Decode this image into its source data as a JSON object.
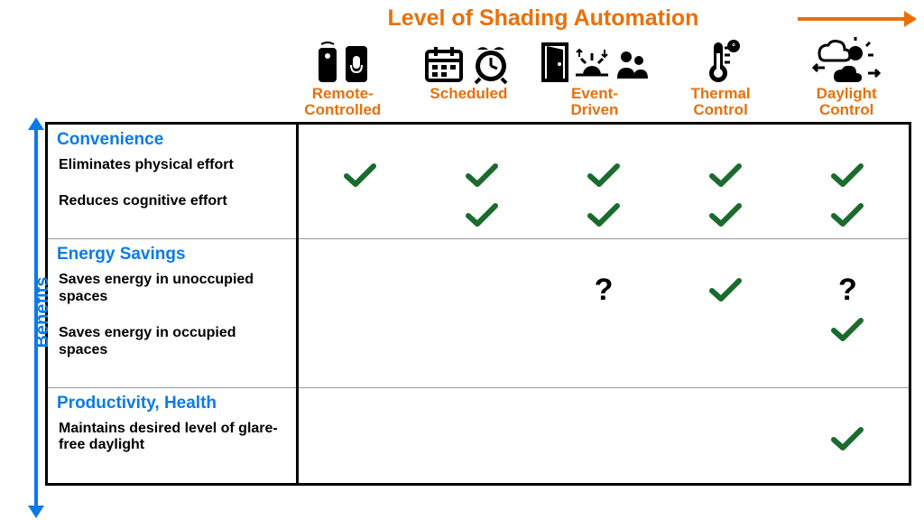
{
  "top_axis_label": "Level of Shading Automation",
  "left_axis_label": "Benefits",
  "columns": [
    {
      "id": "remote",
      "label": "Remote-\nControlled"
    },
    {
      "id": "scheduled",
      "label": "Scheduled"
    },
    {
      "id": "event",
      "label": "Event-\nDriven"
    },
    {
      "id": "thermal",
      "label": "Thermal\nControl"
    },
    {
      "id": "daylight",
      "label": "Daylight\nControl"
    }
  ],
  "groups": [
    {
      "category": "Convenience",
      "rows": [
        {
          "label": "Eliminates physical effort",
          "marks": [
            "check",
            "check",
            "check",
            "check",
            "check"
          ]
        },
        {
          "label": "Reduces cognitive effort",
          "marks": [
            "",
            "check",
            "check",
            "check",
            "check"
          ]
        }
      ]
    },
    {
      "category": "Energy Savings",
      "rows": [
        {
          "label": "Saves energy in unoccupied spaces",
          "marks": [
            "",
            "",
            "question",
            "check",
            "question"
          ]
        },
        {
          "label": "Saves energy in occupied spaces",
          "marks": [
            "",
            "",
            "",
            "",
            "check"
          ]
        }
      ]
    },
    {
      "category": "Productivity, Health",
      "rows": [
        {
          "label": "Maintains desired level of glare-free daylight",
          "marks": [
            "",
            "",
            "",
            "",
            "check"
          ]
        }
      ]
    }
  ],
  "chart_data": {
    "type": "table",
    "x_axis": "Level of Shading Automation",
    "y_axis": "Benefits",
    "columns": [
      "Remote-Controlled",
      "Scheduled",
      "Event-Driven",
      "Thermal Control",
      "Daylight Control"
    ],
    "row_groups": [
      {
        "group": "Convenience",
        "rows": [
          "Eliminates physical effort",
          "Reduces cognitive effort"
        ]
      },
      {
        "group": "Energy Savings",
        "rows": [
          "Saves energy in unoccupied spaces",
          "Saves energy in occupied spaces"
        ]
      },
      {
        "group": "Productivity, Health",
        "rows": [
          "Maintains desired level of glare-free daylight"
        ]
      }
    ],
    "cells": [
      [
        "yes",
        "yes",
        "yes",
        "yes",
        "yes"
      ],
      [
        "",
        "yes",
        "yes",
        "yes",
        "yes"
      ],
      [
        "",
        "",
        "maybe",
        "yes",
        "maybe"
      ],
      [
        "",
        "",
        "",
        "",
        "yes"
      ],
      [
        "",
        "",
        "",
        "",
        "yes"
      ]
    ],
    "legend": {
      "yes": "green check mark",
      "maybe": "question mark",
      "": "blank"
    }
  }
}
